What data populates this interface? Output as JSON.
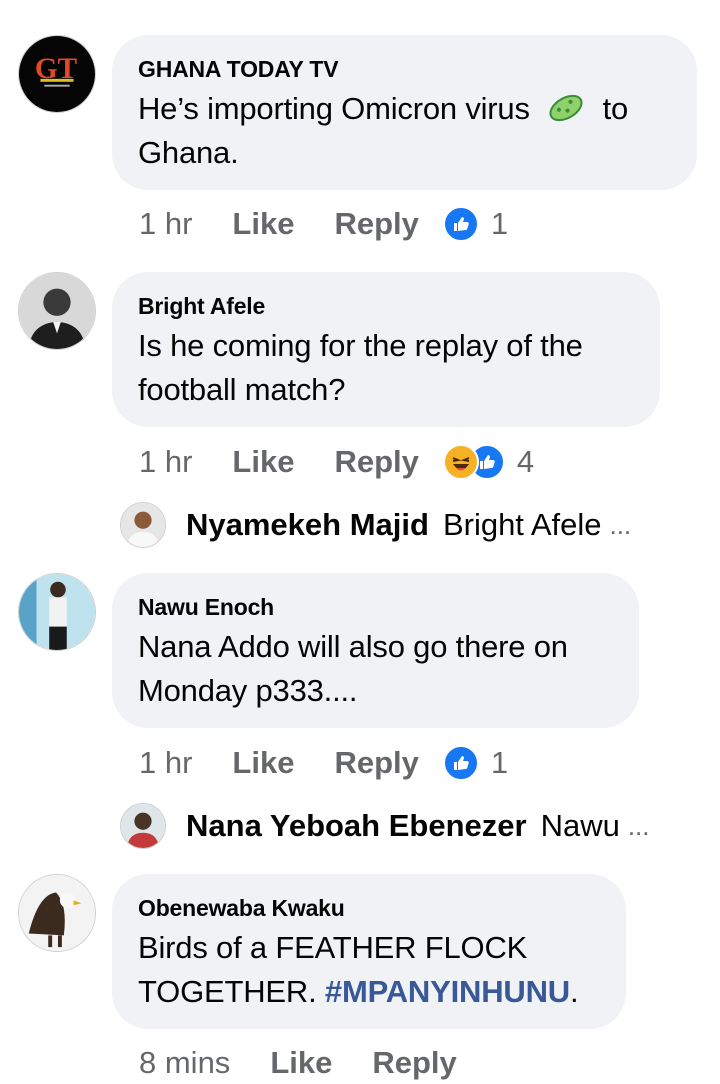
{
  "comments": [
    {
      "author": "GHANA TODAY TV",
      "avatar_text": "GT",
      "text_before": "He’s importing Omicron virus",
      "emoji": "microbe-icon",
      "text_after": "to Ghana.",
      "time": "1 hr",
      "like_label": "Like",
      "reply_label": "Reply",
      "reactions": [
        "like-icon"
      ],
      "reaction_count": "1"
    },
    {
      "author": "Bright Afele",
      "text": "Is he coming for the replay of the football match?",
      "time": "1 hr",
      "like_label": "Like",
      "reply_label": "Reply",
      "reactions": [
        "haha-icon",
        "like-icon"
      ],
      "reaction_count": "4",
      "reply_preview": {
        "name": "Nyamekeh Majid",
        "snippet": "Bright Afele",
        "ellipsis": "..."
      }
    },
    {
      "author": "Nawu Enoch",
      "text": "Nana Addo will also go there on Monday p333....",
      "time": "1 hr",
      "like_label": "Like",
      "reply_label": "Reply",
      "reactions": [
        "like-icon"
      ],
      "reaction_count": "1",
      "reply_preview": {
        "name": "Nana Yeboah Ebenezer",
        "snippet": "Nawu",
        "ellipsis": "..."
      }
    },
    {
      "author": "Obenewaba Kwaku",
      "text_before": "Birds of a FEATHER FLOCK TOGETHER. ",
      "hashtag": "#MPANYINHUNU",
      "text_after": ".",
      "time": "8 mins",
      "like_label": "Like",
      "reply_label": "Reply"
    }
  ],
  "colors": {
    "bubble": "#f0f2f5",
    "meta": "#65676b",
    "link": "#385898",
    "like_blue": "#1877f2",
    "haha_yellow": "#f7b125"
  }
}
